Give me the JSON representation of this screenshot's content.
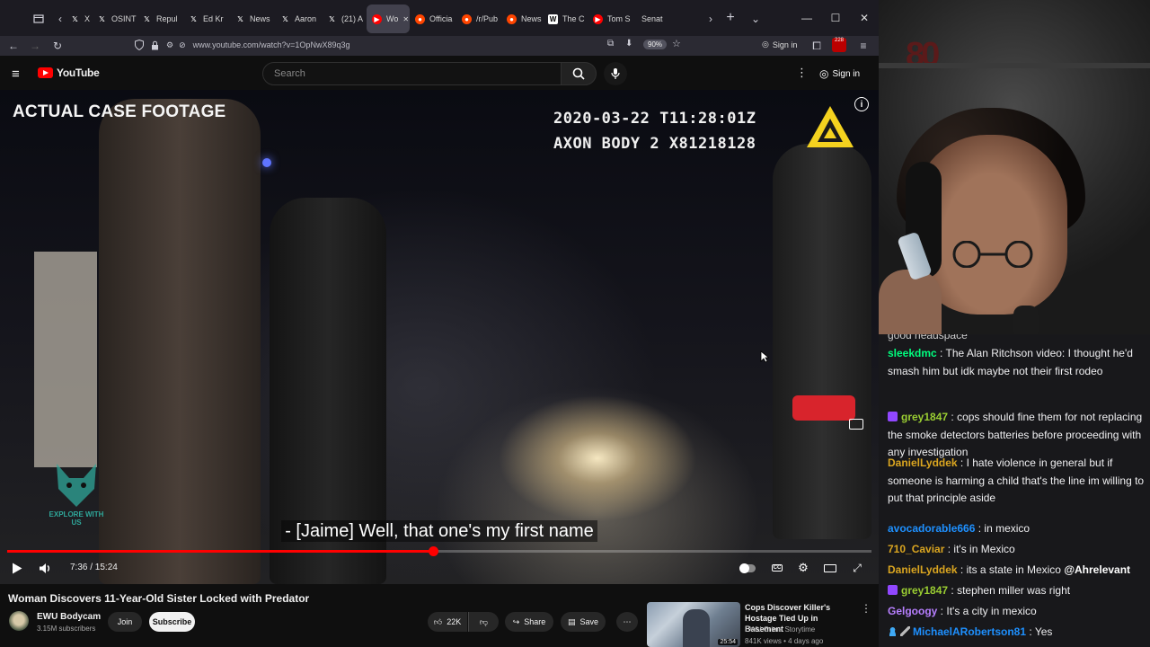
{
  "browser": {
    "tabs": [
      {
        "icon": "x-icon",
        "label": "X"
      },
      {
        "icon": "x-icon",
        "label": "OSINT"
      },
      {
        "icon": "x-icon",
        "label": "Repul"
      },
      {
        "icon": "x-icon",
        "label": "Ed Kr"
      },
      {
        "icon": "x-icon",
        "label": "News"
      },
      {
        "icon": "x-icon",
        "label": "Aaron"
      },
      {
        "icon": "x-icon",
        "label": "(21) A"
      },
      {
        "icon": "youtube-icon",
        "label": "Wo",
        "active": true
      },
      {
        "icon": "reddit-icon",
        "label": "Officia"
      },
      {
        "icon": "reddit-icon",
        "label": "/r/Pub"
      },
      {
        "icon": "reddit-icon",
        "label": "News"
      },
      {
        "icon": "wikipedia-icon",
        "label": "The C"
      },
      {
        "icon": "youtube-icon",
        "label": "Tom S"
      },
      {
        "icon": "",
        "label": "Senat"
      }
    ],
    "url": "www.youtube.com/watch?v=1OpNwX89q3g",
    "zoom": "90%",
    "signin_label": "Sign in",
    "extension_badge": "228"
  },
  "youtube": {
    "logo_text": "YouTube",
    "search_placeholder": "Search",
    "signin_label": "Sign in"
  },
  "video": {
    "overlay_title": "ACTUAL CASE FOOTAGE",
    "timestamp_line1": "2020-03-22 T11:28:01Z",
    "timestamp_line2": "AXON BODY 2 X81218128",
    "watermark_text": "EXPLORE WITH US",
    "subtitle": "- [Jaime] Well, that one's my first name",
    "current_time": "7:36",
    "duration": "15:24",
    "time_display": "7:36 / 15:24",
    "progress": 0.493
  },
  "below_video": {
    "title": "Woman Discovers 11-Year-Old Sister Locked with Predator",
    "channel_name": "EWU Bodycam",
    "channel_subs": "3.15M subscribers",
    "join_label": "Join",
    "subscribe_label": "Subscribe",
    "likes": "22K",
    "share_label": "Share",
    "save_label": "Save"
  },
  "recommended": {
    "title": "Cops Discover Killer's Hostage Tied Up in Basement",
    "channel": "EWU Crime Storytime",
    "meta": "841K views • 4 days ago",
    "duration": "25:54"
  },
  "webcam": {
    "decor_text": "80"
  },
  "chat": {
    "cutoff_text": "good headspace",
    "messages": [
      {
        "user": "sleekdmc",
        "color": "#00ff7f",
        "badge": false,
        "text": "The Alan Ritchson video: I thought he'd smash him but idk maybe not their first rodeo"
      },
      {
        "user": "grey1847",
        "color": "#9acd32",
        "badge": true,
        "text": "cops should fine them for not replacing the smoke detectors batteries before proceeding with any investigation"
      },
      {
        "user": "DanielLyddek",
        "color": "#daa520",
        "badge": false,
        "text": "I hate violence in general but if someone is harming a child that's the line im willing to put that principle aside"
      },
      {
        "user": "avocadorable666",
        "color": "#1e90ff",
        "badge": false,
        "text": "in mexico"
      },
      {
        "user": "710_Caviar",
        "color": "#daa520",
        "badge": false,
        "text": "it's in Mexico"
      },
      {
        "user": "DanielLyddek",
        "color": "#daa520",
        "badge": false,
        "text": "its a state in Mexico",
        "mention": "@Ahrelevant"
      },
      {
        "user": "grey1847",
        "color": "#9acd32",
        "badge": true,
        "text": "stephen miller was right"
      },
      {
        "user": "Gelgoogy",
        "color": "#b77fff",
        "badge": false,
        "text": "It's a city in mexico"
      },
      {
        "user": "MichaelARobertson81",
        "color": "#1e90ff",
        "badge": false,
        "mod": true,
        "text": "Yes"
      }
    ]
  }
}
